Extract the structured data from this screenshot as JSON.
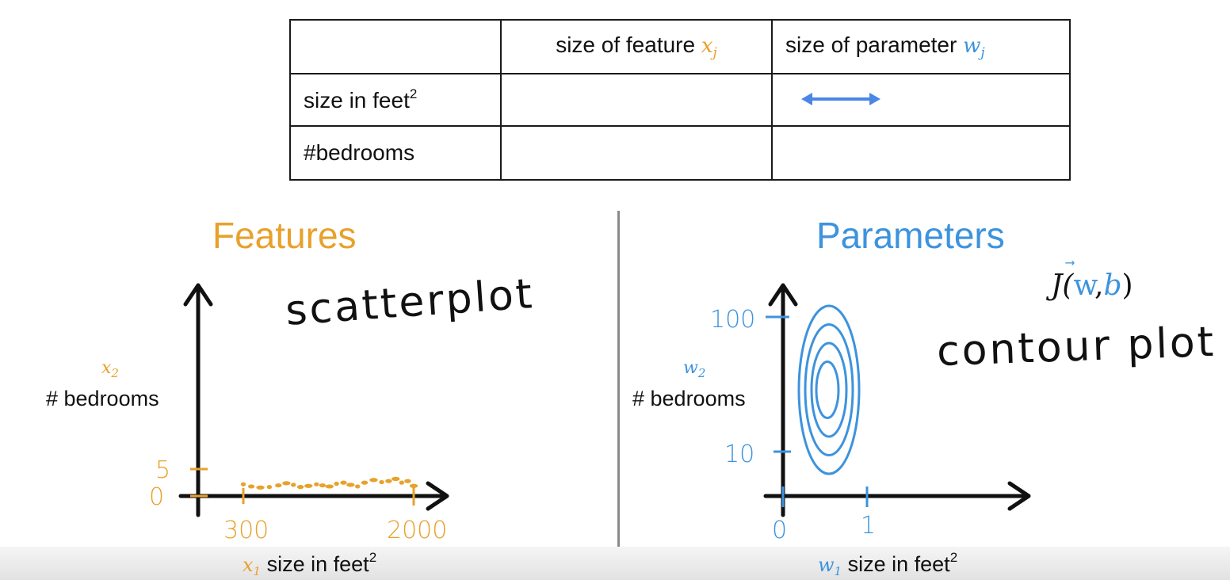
{
  "table": {
    "header": {
      "blank": "",
      "feature_text": "size of feature",
      "feature_var": "x",
      "feature_sub": "j",
      "param_text": "size of parameter",
      "param_var": "w",
      "param_sub": "j"
    },
    "rows": [
      {
        "label": "size in feet",
        "label_sup": "2",
        "has_arrow": true
      },
      {
        "label": "#bedrooms",
        "has_arrow": false
      }
    ]
  },
  "left": {
    "heading": "Features",
    "note": "scatterplot",
    "y_var": "x",
    "y_var_sub": "2",
    "y_label": "# bedrooms",
    "x_var": "x",
    "x_var_sub": "1",
    "x_label": "size in feet",
    "x_label_sup": "2",
    "y_ticks": [
      "5",
      "0"
    ],
    "x_ticks": [
      "300",
      "2000"
    ]
  },
  "right": {
    "heading": "Parameters",
    "cost_J": "J(",
    "cost_w": "w",
    "cost_comma": ",",
    "cost_b": "b",
    "cost_close": ")",
    "note": "contour plot",
    "y_var": "w",
    "y_var_sub": "2",
    "y_label": "# bedrooms",
    "x_var": "w",
    "x_var_sub": "1",
    "x_label": "size in feet",
    "x_label_sup": "2",
    "y_ticks": [
      "100",
      "10"
    ],
    "x_ticks": [
      "0",
      "1"
    ]
  },
  "colors": {
    "feature": "#e8a12b",
    "parameter": "#3d93dd",
    "arrow": "#4a86e8",
    "axis": "#111111"
  },
  "chart_data": [
    {
      "type": "scatter",
      "title": "Features",
      "xlabel": "x1 size in feet2",
      "ylabel": "x2 # bedrooms",
      "xticks": [
        300,
        2000
      ],
      "yticks": [
        0,
        5
      ],
      "points": [
        [
          300,
          1
        ],
        [
          380,
          0.6
        ],
        [
          470,
          0.4
        ],
        [
          560,
          0.5
        ],
        [
          650,
          0.8
        ],
        [
          730,
          1.2
        ],
        [
          800,
          0.9
        ],
        [
          870,
          0.5
        ],
        [
          950,
          0.7
        ],
        [
          1030,
          1
        ],
        [
          1090,
          0.8
        ],
        [
          1160,
          0.6
        ],
        [
          1230,
          1.1
        ],
        [
          1300,
          1.3
        ],
        [
          1370,
          0.9
        ],
        [
          1440,
          0.6
        ],
        [
          1510,
          1.3
        ],
        [
          1600,
          1.8
        ],
        [
          1680,
          1.4
        ],
        [
          1750,
          1.6
        ],
        [
          1820,
          2.0
        ],
        [
          1880,
          1.3
        ],
        [
          1940,
          1.6
        ],
        [
          2000,
          0.7
        ]
      ]
    },
    {
      "type": "contour",
      "title": "Parameters",
      "xlabel": "w1 size in feet2",
      "ylabel": "w2 # bedrooms",
      "xticks": [
        0,
        1
      ],
      "yticks": [
        10,
        100
      ],
      "levels": 4
    }
  ]
}
